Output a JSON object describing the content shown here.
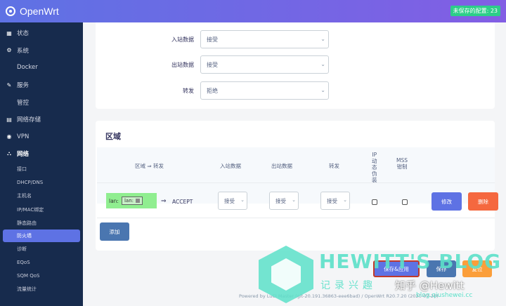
{
  "header": {
    "brand": "OpenWrt",
    "unsaved": "未保存的配置: 23"
  },
  "sidebar": {
    "items": [
      {
        "label": "状态",
        "icon": "grid-icon"
      },
      {
        "label": "系统",
        "icon": "gear-icon"
      },
      {
        "label": "Docker",
        "icon": ""
      },
      {
        "label": "服务",
        "icon": "wrench-icon"
      },
      {
        "label": "管控",
        "icon": ""
      },
      {
        "label": "网络存储",
        "icon": "storage-icon"
      },
      {
        "label": "VPN",
        "icon": "globe-icon"
      },
      {
        "label": "网络",
        "icon": "network-icon"
      }
    ],
    "network_sub": [
      "接口",
      "DHCP/DNS",
      "主机名",
      "IP/MAC绑定",
      "静态路由",
      "防火墙",
      "诊断",
      "EQoS",
      "SQM QoS",
      "流量统计"
    ],
    "active": "防火墙"
  },
  "general": {
    "input_label": "入站数据",
    "input_value": "接受",
    "output_label": "出站数据",
    "output_value": "接受",
    "forward_label": "转发",
    "forward_value": "拒绝"
  },
  "zones": {
    "title": "区域",
    "headers": {
      "zone": "区域 ⇒ 转发",
      "input": "入站数据",
      "output": "出站数据",
      "forward": "转发",
      "masq": "IP\n动\n态\n伪\n装",
      "mss": "MSS\n钳制"
    },
    "row": {
      "zone_name": "lan:",
      "zone_inner": "lan:",
      "arrow": "⇒",
      "dest": "ACCEPT",
      "input": "接受",
      "output": "接受",
      "forward": "接受",
      "edit": "修改",
      "delete": "删除"
    },
    "add": "添加"
  },
  "footer_buttons": {
    "save_apply": "保存&应用",
    "save": "保存",
    "reset": "复位"
  },
  "footer": "Powered by LuCI Master (git-20.191.36863-eee6bad) / OpenWrt R20.7.20 (2020-07-20)",
  "watermark": {
    "title": "HEWITT'S BLOG",
    "sub": "记录兴趣",
    "zh": "知乎 @Hewitt",
    "url": "blog.qiushewei.cc"
  }
}
